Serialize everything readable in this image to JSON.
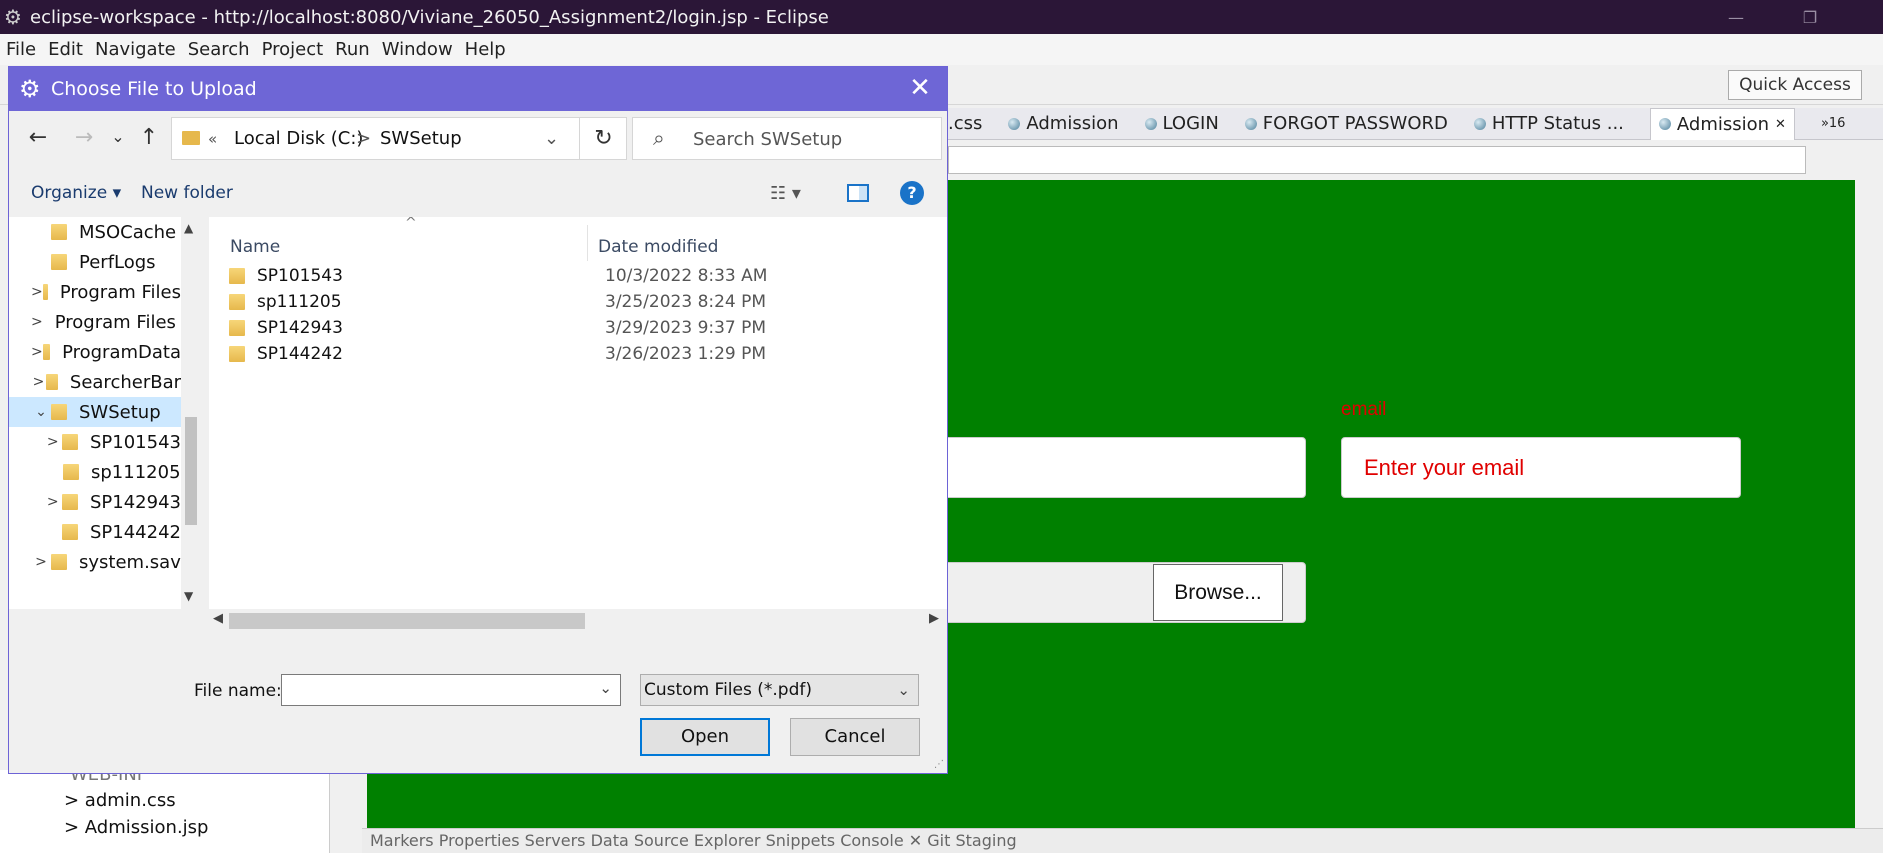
{
  "window": {
    "title": "eclipse-workspace - http://localhost:8080/Viviane_26050_Assignment2/login.jsp - Eclipse",
    "app_icon": "eclipse-gear-icon",
    "minimize_glyph": "—",
    "restore_glyph": "❐"
  },
  "menu": [
    "File",
    "Edit",
    "Navigate",
    "Search",
    "Project",
    "Run",
    "Window",
    "Help"
  ],
  "toolbar": {
    "quick_access": "Quick Access"
  },
  "editor_tabs": [
    {
      "label": ".css",
      "icon": false
    },
    {
      "label": "Admission",
      "icon": true
    },
    {
      "label": "LOGIN",
      "icon": true
    },
    {
      "label": "FORGOT PASSWORD",
      "icon": true
    },
    {
      "label": "HTTP Status ...",
      "icon": true
    },
    {
      "label": "Admission",
      "icon": true,
      "active": true,
      "close": "✕"
    }
  ],
  "overflow_tabs": "»16",
  "page": {
    "email_label": "email",
    "email_placeholder": "Enter your email",
    "browse_button": "Browse...",
    "background_color": "#008000",
    "accent_color": "#e00000"
  },
  "project_tree": [
    {
      "label": "WEB-INF"
    },
    {
      "label": "> admin.css"
    },
    {
      "label": "> Admission.jsp"
    }
  ],
  "bottom_tabs": "Markers  Properties  Servers  Data Source Explorer  Snippets  Console ✕  Git Staging",
  "dialog": {
    "title": "Choose File to Upload",
    "title_icon": "dialog-gear-icon",
    "close_glyph": "✕",
    "accent_color": "#6e66d6",
    "nav": {
      "back": "←",
      "forward": "→",
      "recent": "⌄",
      "up": "↑"
    },
    "address": {
      "overflow": "«",
      "drive": "Local Disk (C:)",
      "separator": ">",
      "folder": "SWSetup",
      "dropdown": "⌄"
    },
    "refresh_glyph": "↻",
    "search_placeholder": "Search SWSetup",
    "organize": "Organize ▾",
    "new_folder": "New folder",
    "help": "?",
    "tree": [
      {
        "label": "MSOCache",
        "chevron": ""
      },
      {
        "label": "PerfLogs",
        "chevron": ""
      },
      {
        "label": "Program Files",
        "chevron": ">"
      },
      {
        "label": "Program Files (",
        "chevron": ">"
      },
      {
        "label": "ProgramData",
        "chevron": ">"
      },
      {
        "label": "SearcherBar",
        "chevron": ">"
      },
      {
        "label": "SWSetup",
        "chevron": "⌄",
        "selected": true
      },
      {
        "label": "SP101543",
        "chevron": ">",
        "indent": true
      },
      {
        "label": "sp111205",
        "chevron": "",
        "indent": true
      },
      {
        "label": "SP142943",
        "chevron": ">",
        "indent": true
      },
      {
        "label": "SP144242",
        "chevron": "",
        "indent": true
      },
      {
        "label": "system.sav",
        "chevron": ">"
      }
    ],
    "columns": {
      "name": "Name",
      "date": "Date modified",
      "sort_glyph": "^"
    },
    "files": [
      {
        "name": "SP101543",
        "date": "10/3/2022 8:33 AM"
      },
      {
        "name": "sp111205",
        "date": "3/25/2023 8:24 PM"
      },
      {
        "name": "SP142943",
        "date": "3/29/2023 9:37 PM"
      },
      {
        "name": "SP144242",
        "date": "3/26/2023 1:29 PM"
      }
    ],
    "file_name_label": "File name:",
    "file_name_value": "",
    "filter": "Custom Files (*.pdf)",
    "open": "Open",
    "cancel": "Cancel"
  }
}
